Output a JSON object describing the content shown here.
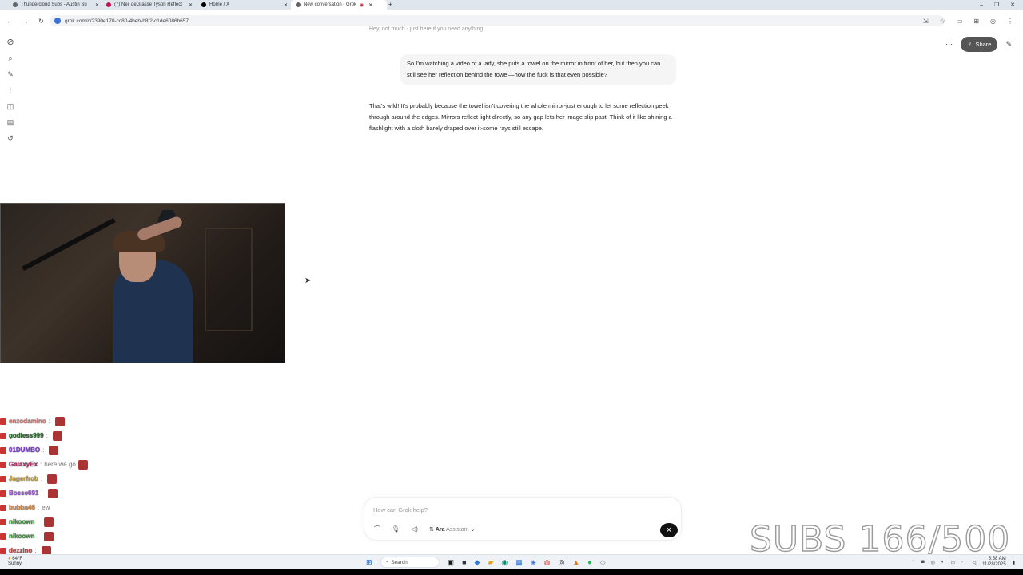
{
  "browser": {
    "tabs": [
      {
        "label": "Thundercloud Subs - Austin Su",
        "active": false
      },
      {
        "label": "(7) Neil deGrasse Tyson Reflect",
        "active": false
      },
      {
        "label": "Home / X",
        "active": false
      },
      {
        "label": "New conversation - Grok",
        "active": true
      }
    ],
    "url": "grok.com/c/2390e170-cc80-4beb-b8f2-c1de6086b657"
  },
  "grok": {
    "share_label": "Share",
    "faded_previous": "Hey, not much - just here if you need anything.",
    "user_message": "So I'm watching a video of a lady, she puts a towel on the mirror in front of her, but then you can still see her reflection behind the towel—how the fuck is that even possible?",
    "assistant_message": "That's wild! It's probably because the towel isn't covering the whole mirror-just enough to let some reflection peek through around the edges. Mirrors reflect light directly, so any gap lets her image slip past. Think of it like shining a flashlight with a cloth barely draped over it-some rays still escape.",
    "composer": {
      "placeholder": "How can Grok help?",
      "voice_name": "Ara",
      "voice_mode": "Assistant"
    }
  },
  "stream_chat": [
    {
      "name": "enzodamino",
      "message": "",
      "color": "#d67b7b",
      "emote": true
    },
    {
      "name": "godless999",
      "message": "",
      "color": "#2a6b2a",
      "emote": true
    },
    {
      "name": "01DUMBO",
      "message": "",
      "color": "#7a3fd6",
      "emote": true
    },
    {
      "name": "GalaxyEx",
      "message": "here we go",
      "color": "#b8326e",
      "emote": true
    },
    {
      "name": "Jagerfrob",
      "message": "",
      "color": "#c9a23a",
      "emote": true
    },
    {
      "name": "Bosse691",
      "message": "",
      "color": "#9a5bd0",
      "emote": true
    },
    {
      "name": "bubba46",
      "message": "ew",
      "color": "#d48b4d",
      "emote": false
    },
    {
      "name": "nikoown",
      "message": "",
      "color": "#3c9c3c",
      "emote": true
    },
    {
      "name": "nikoown",
      "message": "",
      "color": "#3c9c3c",
      "emote": true
    },
    {
      "name": "dezzino",
      "message": "",
      "color": "#c04b4b",
      "emote": true
    }
  ],
  "overlay": {
    "subs_text": "SUBS 166/500"
  },
  "taskbar": {
    "weather_temp": "64°F",
    "weather_desc": "Sunny",
    "search_label": "Search",
    "time": "5:58 AM",
    "date": "11/28/2025"
  }
}
